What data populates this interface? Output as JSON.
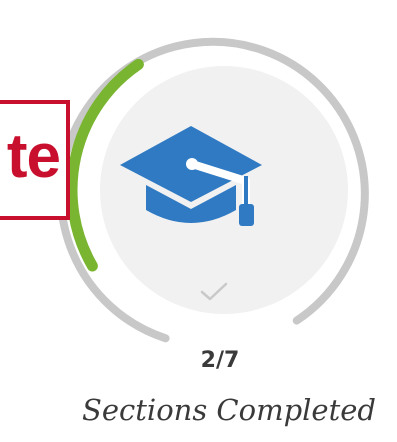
{
  "progress": {
    "completed": 2,
    "total": 7,
    "fraction": 0.2857,
    "value_text": "2/7",
    "caption": "Sections Completed"
  },
  "badge": {
    "text": "te"
  },
  "icons": {
    "main": "graduation-cap-icon",
    "status": "checkmark-icon"
  },
  "colors": {
    "progress_fill": "#7ab531",
    "ring_track": "#c8c8c8",
    "cap_blue": "#2f7ac3",
    "badge_red": "#c8102e",
    "text": "#3a3a3a"
  }
}
